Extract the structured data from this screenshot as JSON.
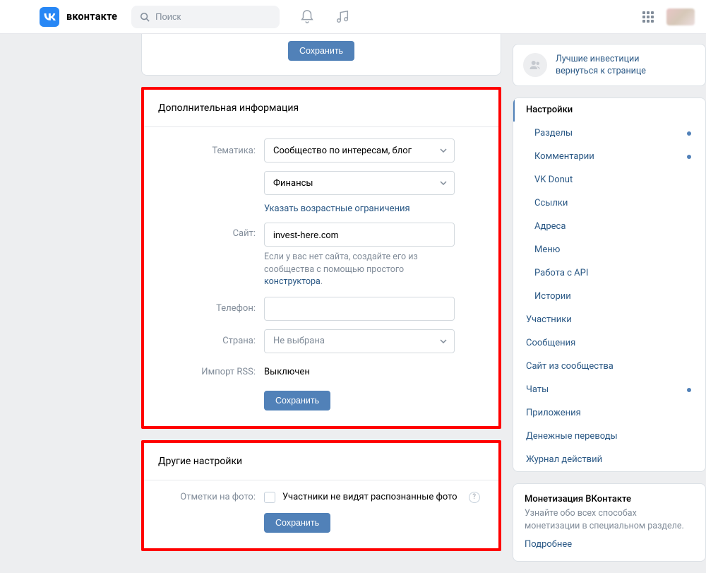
{
  "header": {
    "brand": "вконтакте",
    "search_placeholder": "Поиск"
  },
  "top_save_label": "Сохранить",
  "section_additional": {
    "title": "Дополнительная информация",
    "labels": {
      "topic": "Тематика:",
      "site": "Сайт:",
      "phone": "Телефон:",
      "country": "Страна:",
      "rss": "Импорт RSS:"
    },
    "topic_value": "Сообщество по интересам, блог",
    "subtopic_value": "Финансы",
    "age_link": "Указать возрастные ограничения",
    "site_value": "invest-here.com",
    "site_help_prefix": "Если у вас нет сайта, создайте его из сообщества с помощью простого ",
    "site_help_link": "конструктора",
    "site_help_suffix": ".",
    "phone_value": "",
    "country_value": "Не выбрана",
    "rss_value": "Выключен",
    "save_label": "Сохранить"
  },
  "section_other": {
    "title": "Другие настройки",
    "labels": {
      "photo_marks": "Отметки на фото:"
    },
    "photo_checkbox_label": "Участники не видят распознанные фото",
    "save_label": "Сохранить"
  },
  "sidebar": {
    "back_title": "Лучшие инвестиции",
    "back_sub": "вернуться к странице",
    "items": [
      {
        "label": "Настройки",
        "active": true,
        "sub": false,
        "dot": false
      },
      {
        "label": "Разделы",
        "active": false,
        "sub": true,
        "dot": true
      },
      {
        "label": "Комментарии",
        "active": false,
        "sub": true,
        "dot": true
      },
      {
        "label": "VK Donut",
        "active": false,
        "sub": true,
        "dot": false
      },
      {
        "label": "Ссылки",
        "active": false,
        "sub": true,
        "dot": false
      },
      {
        "label": "Адреса",
        "active": false,
        "sub": true,
        "dot": false
      },
      {
        "label": "Меню",
        "active": false,
        "sub": true,
        "dot": false
      },
      {
        "label": "Работа с API",
        "active": false,
        "sub": true,
        "dot": false
      },
      {
        "label": "Истории",
        "active": false,
        "sub": true,
        "dot": false
      },
      {
        "label": "Участники",
        "active": false,
        "sub": false,
        "dot": false
      },
      {
        "label": "Сообщения",
        "active": false,
        "sub": false,
        "dot": false
      },
      {
        "label": "Сайт из сообщества",
        "active": false,
        "sub": false,
        "dot": false
      },
      {
        "label": "Чаты",
        "active": false,
        "sub": false,
        "dot": true
      },
      {
        "label": "Приложения",
        "active": false,
        "sub": false,
        "dot": false
      },
      {
        "label": "Денежные переводы",
        "active": false,
        "sub": false,
        "dot": false
      },
      {
        "label": "Журнал действий",
        "active": false,
        "sub": false,
        "dot": false
      }
    ]
  },
  "monetization": {
    "title": "Монетизация ВКонтакте",
    "text": "Узнайте обо всех способах монетизации в специальном разделе.",
    "link": "Подробнее"
  }
}
